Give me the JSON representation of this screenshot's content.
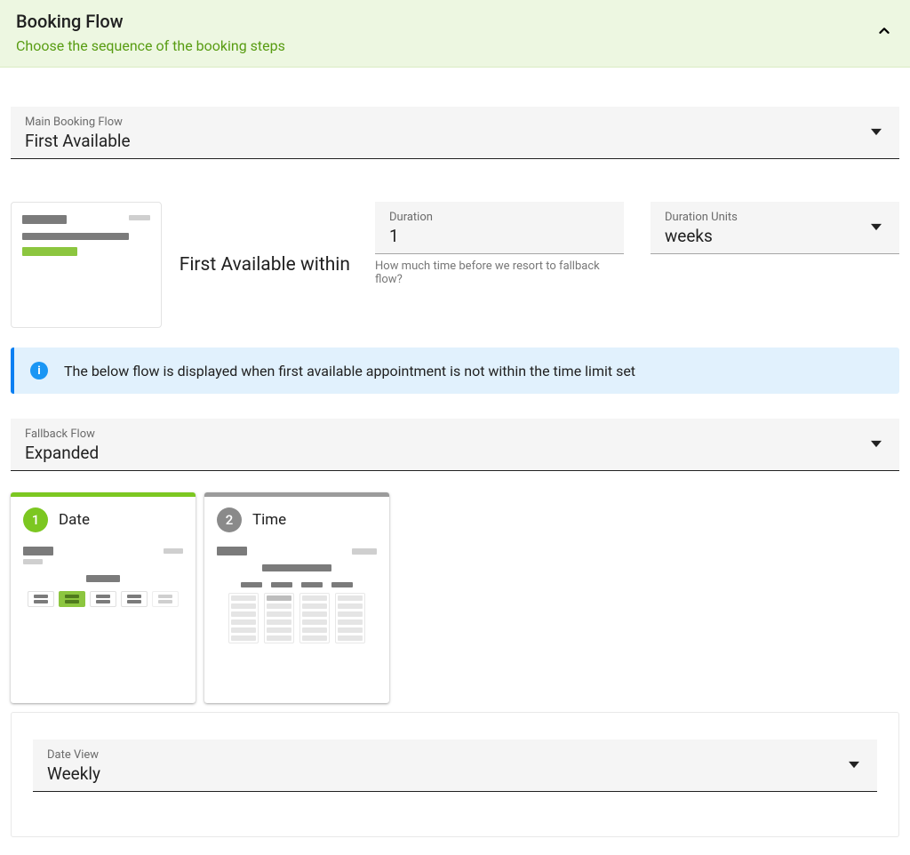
{
  "header": {
    "title": "Booking Flow",
    "subtitle": "Choose the sequence of the booking steps"
  },
  "main_flow": {
    "label": "Main Booking Flow",
    "value": "First Available"
  },
  "first_available": {
    "label": "First Available within",
    "duration": {
      "label": "Duration",
      "value": "1",
      "helper": "How much time before we resort to fallback flow?"
    },
    "units": {
      "label": "Duration Units",
      "value": "weeks"
    }
  },
  "info_banner": {
    "text": "The below flow is displayed when first available appointment is not within the time limit set"
  },
  "fallback_flow": {
    "label": "Fallback Flow",
    "value": "Expanded"
  },
  "steps": [
    {
      "number": "1",
      "title": "Date",
      "active": true
    },
    {
      "number": "2",
      "title": "Time",
      "active": false
    }
  ],
  "date_view": {
    "label": "Date View",
    "value": "Weekly"
  },
  "colors": {
    "accent_green": "#7cc721",
    "header_bg": "#edf7e1",
    "info_bg": "#e1f1fd",
    "info_border": "#0a7ff2"
  }
}
